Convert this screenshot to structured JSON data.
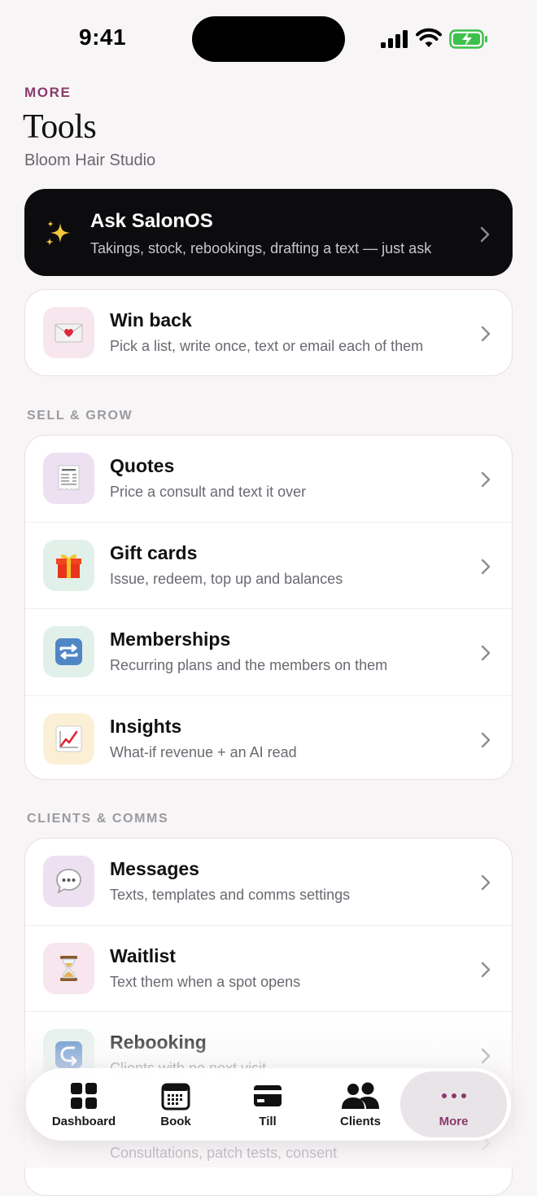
{
  "status": {
    "time": "9:41"
  },
  "header": {
    "eyebrow": "MORE",
    "title": "Tools",
    "studio": "Bloom Hair Studio"
  },
  "ask": {
    "title": "Ask SalonOS",
    "subtitle": "Takings, stock, rebookings, drafting a text — just ask",
    "icon": "sparkles-icon"
  },
  "winback": {
    "title": "Win back",
    "subtitle": "Pick a list, write once, text or email each of them",
    "icon": "love-letter-icon"
  },
  "sections": {
    "sell": {
      "label": "SELL & GROW",
      "items": [
        {
          "title": "Quotes",
          "subtitle": "Price a consult and text it over",
          "icon": "receipt-icon"
        },
        {
          "title": "Gift cards",
          "subtitle": "Issue, redeem, top up and balances",
          "icon": "gift-icon"
        },
        {
          "title": "Memberships",
          "subtitle": "Recurring plans and the members on them",
          "icon": "repeat-icon"
        },
        {
          "title": "Insights",
          "subtitle": "What-if revenue + an AI read",
          "icon": "chart-increasing-icon"
        }
      ]
    },
    "clients": {
      "label": "CLIENTS & COMMS",
      "items": [
        {
          "title": "Messages",
          "subtitle": "Texts, templates and comms settings",
          "icon": "speech-bubble-icon"
        },
        {
          "title": "Waitlist",
          "subtitle": "Text them when a spot opens",
          "icon": "hourglass-icon"
        },
        {
          "title": "Rebooking",
          "subtitle": "Clients with no next visit",
          "icon": "return-arrow-icon"
        }
      ],
      "partial_subtitle": "Consultations, patch tests, consent"
    }
  },
  "tabs": [
    {
      "label": "Dashboard",
      "icon": "dashboard-icon"
    },
    {
      "label": "Book",
      "icon": "calendar-icon"
    },
    {
      "label": "Till",
      "icon": "card-icon"
    },
    {
      "label": "Clients",
      "icon": "people-icon"
    },
    {
      "label": "More",
      "icon": "more-dots-icon",
      "active": true
    }
  ],
  "colors": {
    "accent": "#8a3a6b",
    "background": "#f8f5f7",
    "ask_card": "#0c0c0e"
  }
}
